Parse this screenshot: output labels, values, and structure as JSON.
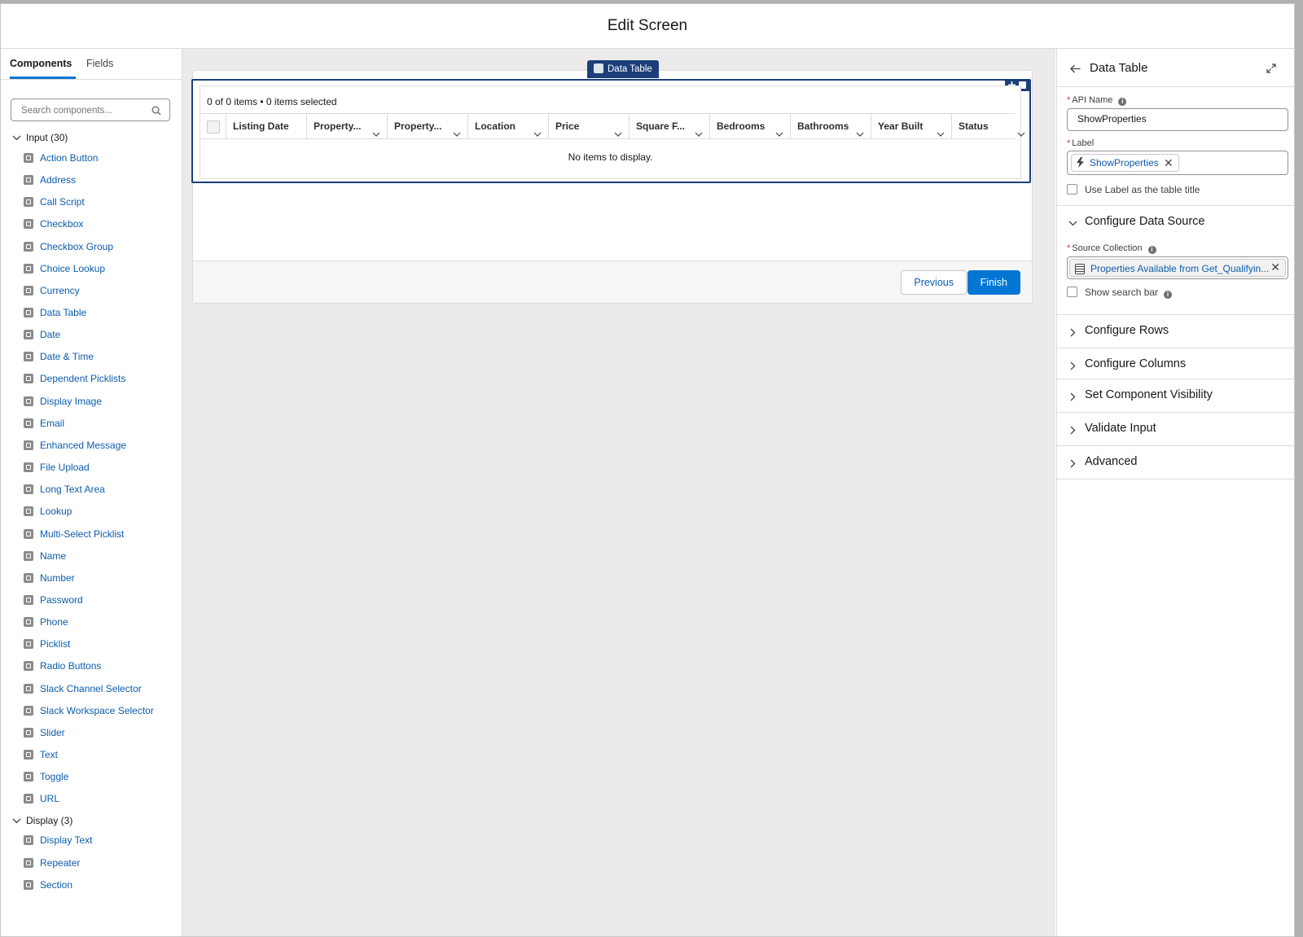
{
  "header": {
    "title": "Edit Screen"
  },
  "left": {
    "tabs": [
      "Components",
      "Fields"
    ],
    "search_placeholder": "Search components...",
    "groups": [
      {
        "label": "Input (30)",
        "items": [
          "Action Button",
          "Address",
          "Call Script",
          "Checkbox",
          "Checkbox Group",
          "Choice Lookup",
          "Currency",
          "Data Table",
          "Date",
          "Date & Time",
          "Dependent Picklists",
          "Display Image",
          "Email",
          "Enhanced Message",
          "File Upload",
          "Long Text Area",
          "Lookup",
          "Multi-Select Picklist",
          "Name",
          "Number",
          "Password",
          "Phone",
          "Picklist",
          "Radio Buttons",
          "Slack Channel Selector",
          "Slack Workspace Selector",
          "Slider",
          "Text",
          "Toggle",
          "URL"
        ]
      },
      {
        "label": "Display (3)",
        "items": [
          "Display Text",
          "Repeater",
          "Section"
        ]
      }
    ]
  },
  "canvas": {
    "component_tag": "Data Table",
    "count_text": "0 of 0 items • 0 items selected",
    "columns": [
      "Listing Date",
      "Property...",
      "Property...",
      "Location",
      "Price",
      "Square F...",
      "Bedrooms",
      "Bathrooms",
      "Year Built",
      "Status"
    ],
    "empty_text": "No items to display.",
    "previous_label": "Previous",
    "finish_label": "Finish"
  },
  "properties": {
    "title": "Data Table",
    "api_name_label": "API Name",
    "api_name_value": "ShowProperties",
    "label_label": "Label",
    "label_value": "ShowProperties",
    "use_label_text": "Use Label as the table title",
    "sections": [
      "Configure Data Source",
      "Configure Rows",
      "Configure Columns",
      "Set Component Visibility",
      "Validate Input",
      "Advanced"
    ],
    "source_collection_label": "Source Collection",
    "source_collection_value": "Properties Available from Get_Qualifyin...",
    "show_search_bar_text": "Show search bar"
  },
  "colors": {
    "brand": "#0176d3",
    "selection": "#1b3f78",
    "link": "#0b5cab",
    "canvas_bg": "#eceaea"
  }
}
